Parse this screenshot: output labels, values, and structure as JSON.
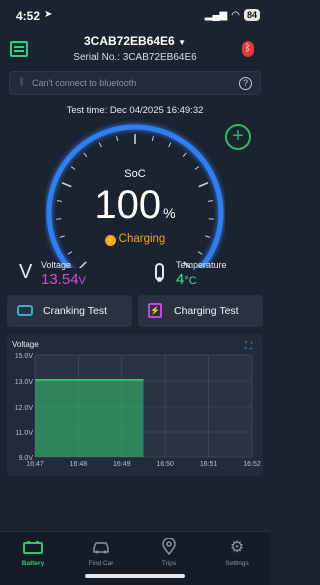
{
  "status_bar": {
    "time": "4:52",
    "battery": "84"
  },
  "header": {
    "device_name": "3CAB72EB64E6",
    "serial_label": "Serial No.: 3CAB72EB64E6"
  },
  "bluetooth_bar": {
    "text": "Can't connect to bluetooth",
    "help": "?"
  },
  "test_time": "Test time: Dec 04/2025 16:49:32",
  "gauge": {
    "label": "SoC",
    "value": "100",
    "unit": "%",
    "level": 1.0,
    "status": "Charging",
    "accent": "#2f7ff0"
  },
  "metrics": {
    "voltage": {
      "label": "Voltage",
      "value": "13.54",
      "unit": "V",
      "color": "#d54bd8"
    },
    "temperature": {
      "label": "Temperature",
      "value": "4",
      "unit": "°C",
      "color": "#46d9a0"
    }
  },
  "buttons": {
    "cranking": "Cranking Test",
    "charging": "Charging Test"
  },
  "chart_data": {
    "type": "area",
    "title": "Voltage",
    "ylim": [
      9.0,
      15.0
    ],
    "y_ticks": [
      "15.0V",
      "13.0V",
      "12.0V",
      "11.0V",
      "9.0V"
    ],
    "y_tick_values": [
      15.0,
      13.0,
      12.0,
      11.0,
      9.0
    ],
    "x_ticks": [
      "16:47",
      "16:48",
      "16:49",
      "16:50",
      "16:51",
      "16:52"
    ],
    "series": [
      {
        "x": [
          "16:47",
          "16:49.5"
        ],
        "values": [
          13.54,
          13.54
        ]
      }
    ],
    "color": "#2fc86e"
  },
  "nav": {
    "items": [
      {
        "label": "Battery",
        "icon": "battery-icon",
        "active": true
      },
      {
        "label": "Find Car",
        "icon": "car-icon"
      },
      {
        "label": "Trips",
        "icon": "location-pin-icon"
      },
      {
        "label": "Settings",
        "icon": "gear-icon"
      }
    ]
  }
}
